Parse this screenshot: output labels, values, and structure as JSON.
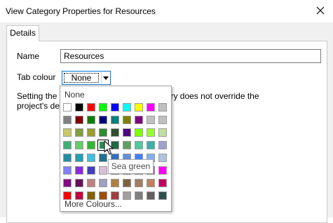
{
  "window": {
    "title": "View Category Properties for Resources",
    "close_icon": "close-icon"
  },
  "tabs": [
    {
      "label": "Details",
      "active": true
    }
  ],
  "form": {
    "name_label": "Name",
    "name_value": "Resources",
    "tab_colour_label": "Tab colour",
    "tab_colour_value": "None",
    "description_line1": "Setting the tab colour for this view category does not override the",
    "description_line2": "project's default."
  },
  "colour_picker": {
    "none_label": "None",
    "more_label": "More Colours...",
    "selected": {
      "row": 3,
      "col": 3
    },
    "swatches": [
      [
        "#ffffff",
        "#000000",
        "#ff0000",
        "#00ff00",
        "#0000ff",
        "#00ffff",
        "#ffff00",
        "#ff00ff",
        "#c0c0c0"
      ],
      [
        "#808080",
        "#800000",
        "#008000",
        "#000080",
        "#008080",
        "#808000",
        "#800080",
        "#c0c0c0",
        "#c0c0c0"
      ],
      [
        "#c8c864",
        "#80a040",
        "#9c9c30",
        "#2e8b2e",
        "#2f4f2f",
        "#4b0082",
        "#80ff00",
        "#99ff33",
        "#c0e0a0"
      ],
      [
        "#3cb371",
        "#66cc66",
        "#2eb82e",
        "#2e8b57",
        "#226644",
        "#5fa060",
        "#50c8a0",
        "#3cb0a8",
        "#a0a0d0"
      ],
      [
        "#1e90a0",
        "#20a0b0",
        "#40c0e0",
        "#1e7090",
        "#3070c0",
        "#6090e0",
        "#4080ff",
        "#80b0ff",
        "#b0c4de"
      ],
      [
        "#8080ff",
        "#8a2be2",
        "#4040c0",
        "#d8bfd8",
        "#dda0dd",
        "#c080c0",
        "#b060b0",
        "#e060e0",
        "#ff00ff"
      ],
      [
        "#8b008b",
        "#6a0d5a",
        "#c08080",
        "#a0a0c0",
        "#b08040",
        "#806040",
        "#a08060",
        "#c08060",
        "#c00060"
      ],
      [
        "#ff0000",
        "#c00040",
        "#806000",
        "#9c5000",
        "#a04040",
        "#a0a0a0",
        "#808080",
        "#606060",
        "#2f4f4f"
      ]
    ],
    "tooltip": "Sea green"
  }
}
